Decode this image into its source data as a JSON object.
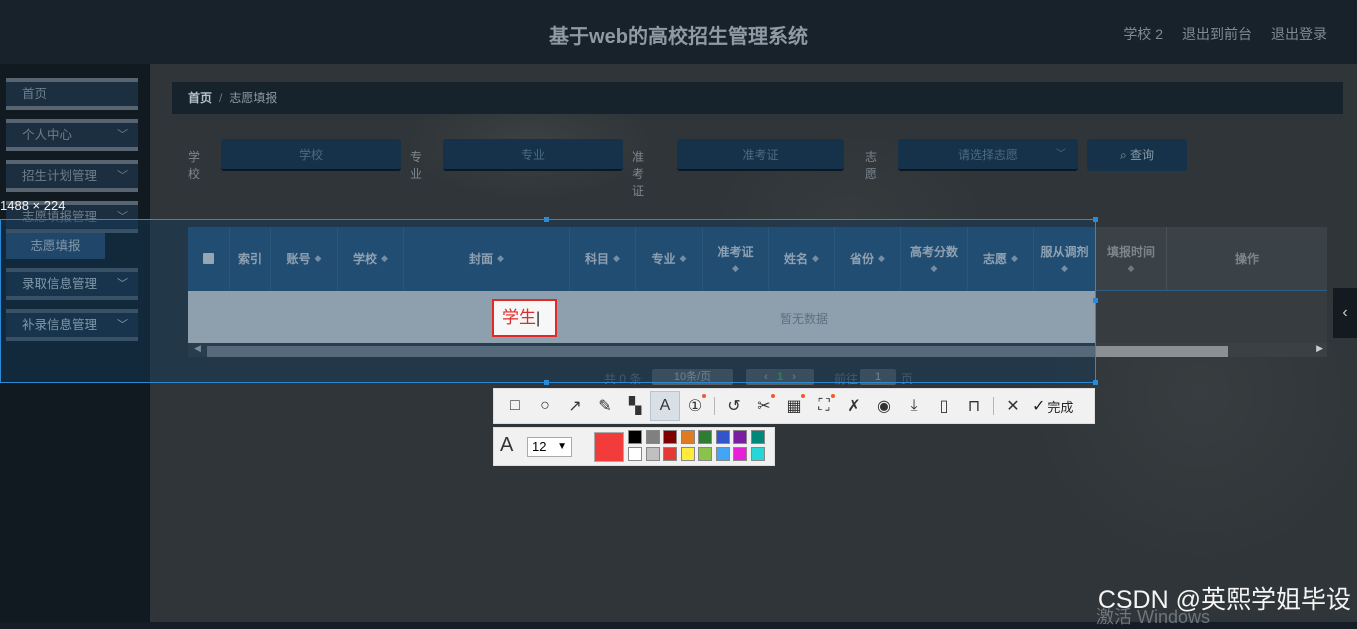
{
  "header": {
    "title": "基于web的高校招生管理系统",
    "nav": [
      "学校 2",
      "退出到前台",
      "退出登录"
    ]
  },
  "sidebar": {
    "items": [
      {
        "label": "首页",
        "chev": false
      },
      {
        "label": "个人中心",
        "chev": true
      },
      {
        "label": "招生计划管理",
        "chev": true
      },
      {
        "label": "志愿填报管理",
        "chev": true
      },
      {
        "label": "录取信息管理",
        "chev": true
      },
      {
        "label": "补录信息管理",
        "chev": true
      }
    ],
    "sub_item": "志愿填报"
  },
  "breadcrumb": {
    "home": "首页",
    "sep": "/",
    "current": "志愿填报"
  },
  "filters": {
    "school_label": "学校",
    "school_placeholder": "学校",
    "major_label": "专业",
    "major_placeholder": "专业",
    "exam_label": "准考证",
    "exam_placeholder": "准考证",
    "wish_label": "志愿",
    "wish_placeholder": "请选择志愿",
    "search_label": "查询"
  },
  "table": {
    "columns": [
      "索引",
      "账号",
      "学校",
      "封面",
      "科目",
      "专业",
      "准考证",
      "姓名",
      "省份",
      "高考分数",
      "志愿",
      "服从调剂",
      "填报时间",
      "操作"
    ],
    "empty": "暂无数据"
  },
  "pager": {
    "total": "共 0 条",
    "page_size": "10条/页",
    "page": "1",
    "goto": "前往",
    "goto_value": "1",
    "unit": "页"
  },
  "screenshot_tool": {
    "size_label": "1488 × 224",
    "text_annotation": "学生",
    "done_label": "完成",
    "font_size": "12",
    "current_color": "#f23b3b",
    "colors_row1": [
      "#000000",
      "#808080",
      "#800000",
      "#e07b20",
      "#2e7d32",
      "#3355cc",
      "#7b1fa2",
      "#00897b"
    ],
    "colors_row2": [
      "#ffffff",
      "#c0c0c0",
      "#e53935",
      "#ffeb3b",
      "#8bc34a",
      "#42a5f5",
      "#e91ed9",
      "#26d7d7"
    ]
  },
  "watermark": "CSDN @英熙学姐毕设",
  "activate_text": "激活 Windows"
}
